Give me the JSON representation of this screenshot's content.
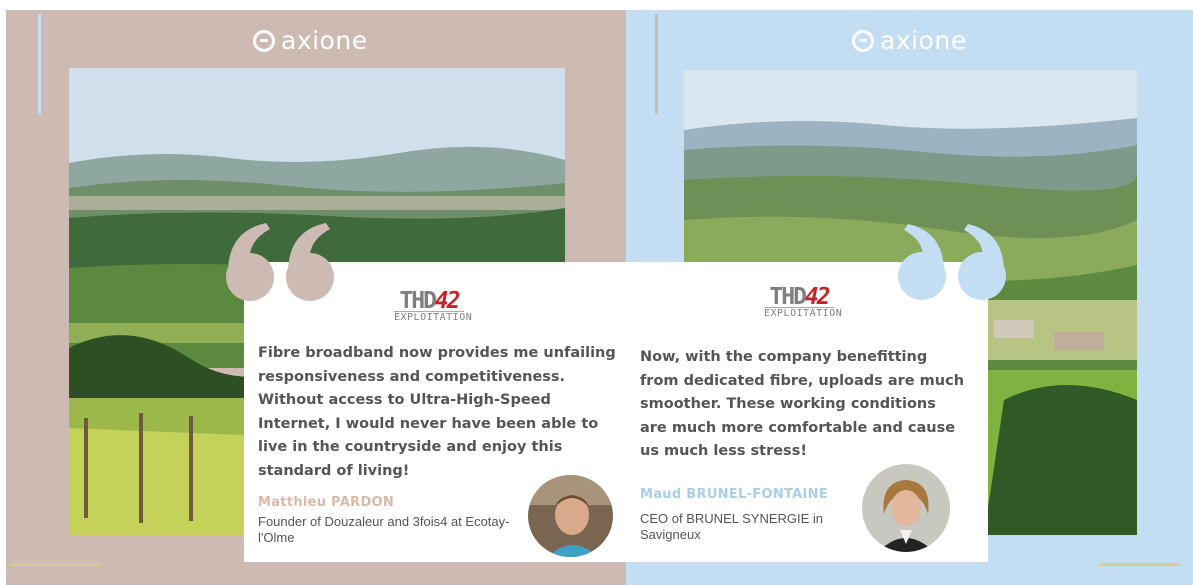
{
  "brand": {
    "name": "axione"
  },
  "left": {
    "partner_logo": {
      "text_main": "THD",
      "text_number": "42",
      "text_sub": "EXPLOITATION"
    },
    "quote": "Fibre broadband now provides me unfailing responsiveness and competitiveness. Without access to Ultra-High-Speed Internet, I would never have been able to live in the countryside and enjoy this standard of living!",
    "author_name": "Matthieu PARDON",
    "author_role": "Founder of Douzaleur and 3fois4 at Ecotay-l'Olme"
  },
  "right": {
    "partner_logo": {
      "text_main": "THD",
      "text_number": "42",
      "text_sub": "EXPLOITATION"
    },
    "quote": "Now, with the company benefitting from dedicated fibre, uploads are much smoother. These working conditions are much more comfortable and cause us much less stress!",
    "author_name": "Maud BRUNEL-FONTAINE",
    "author_role": "CEO of BRUNEL SYNERGIE in Savigneux"
  },
  "colors": {
    "left_panel": "#cdbbb3",
    "right_panel": "#c3ddf3",
    "left_name": "#d9b9a8",
    "right_name": "#a9cdeb",
    "logo_red": "#c3232c"
  },
  "icons": {
    "left_quote": "open-quote-icon",
    "right_quote": "close-quote-icon",
    "brand_mark": "axione-logo-icon"
  }
}
